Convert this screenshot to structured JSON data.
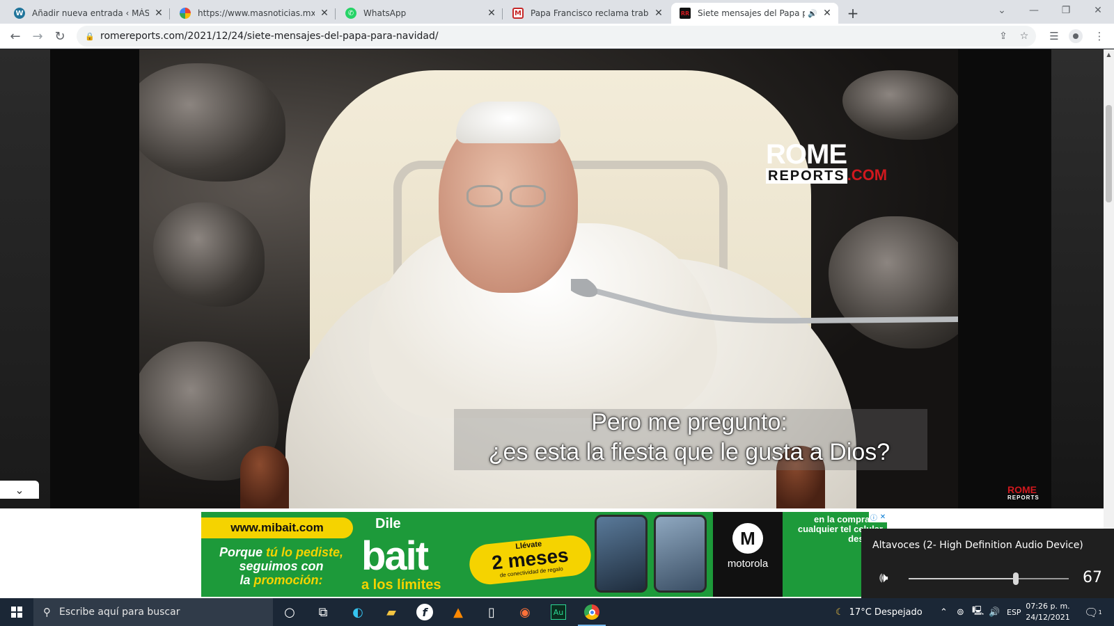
{
  "browser": {
    "tabs": [
      {
        "title": "Añadir nueva entrada ‹ MÁSNOTI",
        "favicon": "wordpress-icon"
      },
      {
        "title": "https://www.masnoticias.mx",
        "favicon": "colorful-site-icon"
      },
      {
        "title": "WhatsApp",
        "favicon": "whatsapp-icon"
      },
      {
        "title": "Papa Francisco reclama trabajos",
        "favicon": "milenio-icon"
      },
      {
        "title": "Siete mensajes del Papa para",
        "favicon": "romereports-icon",
        "audio": "speaker-icon",
        "active": true
      }
    ],
    "url": "romereports.com/2021/12/24/siete-mensajes-del-papa-para-navidad/"
  },
  "video": {
    "logo_line1": "ROME",
    "logo_line2": "REPORTS",
    "logo_suffix": ".COM",
    "small_logo_line1": "ROME",
    "small_logo_line2": "REPORTS",
    "subtitle_line1": "Pero me pregunto:",
    "subtitle_line2": "¿es esta la fiesta que le gusta a Dios?"
  },
  "ad": {
    "site": "www.mibait.com",
    "promo_1": "Porque",
    "promo_2": "tú lo pediste,",
    "promo_3": "seguimos con",
    "promo_4": "la",
    "promo_5": "promoción:",
    "dile": "Dile",
    "brand": "bait",
    "tagline": "a los límites",
    "pill_top": "Llévate",
    "pill_main": "2 meses",
    "pill_bottom": "de conectividad de regalo",
    "moto_brand": "motorola",
    "fine_text": "en la compra de cualquier tel celular desbloq"
  },
  "volume": {
    "device": "Altavoces (2- High Definition Audio Device)",
    "level": 67
  },
  "taskbar": {
    "search_placeholder": "Escribe aquí para buscar",
    "weather": "17°C  Despejado",
    "lang": "ESP",
    "time": "07:26 p. m.",
    "date": "24/12/2021",
    "notif_count": "1"
  },
  "colors": {
    "accent": "#1a73e8",
    "romereports_red": "#d0181e",
    "bait_green": "#1d9a3a",
    "bait_yellow": "#f5d300",
    "taskbar": "#1b2736"
  }
}
